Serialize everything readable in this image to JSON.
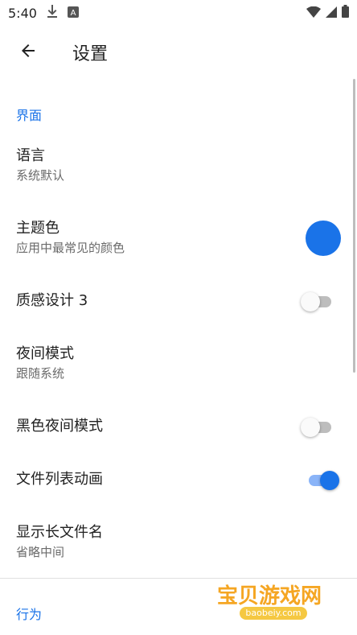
{
  "status_bar": {
    "time": "5:40",
    "icons_left": [
      "download-icon",
      "a-badge-icon"
    ],
    "icons_right": [
      "wifi-icon",
      "signal-icon",
      "battery-icon"
    ]
  },
  "toolbar": {
    "title": "设置",
    "back_icon": "arrow-back-icon"
  },
  "sections": {
    "interface": {
      "header": "界面",
      "language": {
        "title": "语言",
        "summary": "系统默认"
      },
      "theme_color": {
        "title": "主题色",
        "summary": "应用中最常见的颜色",
        "color": "#1a73e8"
      },
      "material3": {
        "title": "质感设计 3",
        "checked": false
      },
      "night_mode": {
        "title": "夜间模式",
        "summary": "跟随系统"
      },
      "black_night": {
        "title": "黑色夜间模式",
        "checked": false
      },
      "file_list_anim": {
        "title": "文件列表动画",
        "checked": true
      },
      "long_filename": {
        "title": "显示长文件名",
        "summary": "省略中间"
      }
    },
    "behavior": {
      "header": "行为"
    }
  },
  "watermark": {
    "text": "宝贝游戏网",
    "url": "baobeiy.com"
  },
  "colors": {
    "accent": "#1a73e8",
    "accent_light": "#8ab4f8"
  }
}
